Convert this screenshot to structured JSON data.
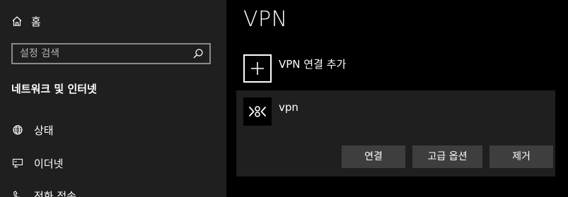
{
  "sidebar": {
    "home_label": "홈",
    "search_placeholder": "설정 검색",
    "section_title": "네트워크 및 인터넷",
    "items": [
      {
        "label": "상태",
        "icon": "globe-icon"
      },
      {
        "label": "이더넷",
        "icon": "ethernet-icon"
      },
      {
        "label": "전화 접속",
        "icon": "dial-up-icon"
      }
    ]
  },
  "main": {
    "title": "VPN",
    "add_vpn_label": "VPN 연결 추가",
    "connection": {
      "name": "vpn",
      "buttons": {
        "connect": "연결",
        "advanced": "고급 옵션",
        "remove": "제거"
      }
    }
  }
}
